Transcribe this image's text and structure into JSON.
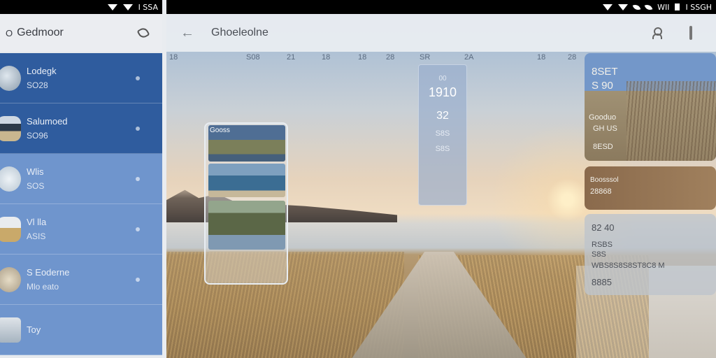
{
  "status_left": {
    "text": "I SSA"
  },
  "status_right": {
    "text1": "WII",
    "text2": "I SSGH"
  },
  "left": {
    "back_label": "O",
    "title": "Gedmoor",
    "items": [
      {
        "title": "Lodegk",
        "sub": "SO28"
      },
      {
        "title": "Salumoed",
        "sub": "SO96"
      },
      {
        "title": "Wlis",
        "sub": "SOS"
      },
      {
        "title": "Vl lla",
        "sub": "ASIS"
      },
      {
        "title": "S Eoderne",
        "sub": "Mlo eato"
      },
      {
        "title": "Toy",
        "sub": ""
      }
    ]
  },
  "right": {
    "title": "Ghoeleolne",
    "timeline": [
      "18",
      "S08",
      "21",
      "18",
      "18",
      "28",
      "SR",
      "2A",
      "18",
      "28"
    ],
    "gallery_title": "Gooss",
    "time_card": {
      "small": "00",
      "big": "1910",
      "med": "32",
      "tiny1": "S8S",
      "tiny2": "S8S"
    },
    "card1": {
      "line1": "8SET",
      "line2": "S 90",
      "line3": "Gooduo",
      "line4": "GH US",
      "line5": "8ESD"
    },
    "card2": {
      "line1": "Boosssol",
      "line2": "28868"
    },
    "card3": {
      "line1": "82 40",
      "line2": "RSBS",
      "line3": "S8S",
      "line4": "WBS8S8S8ST8C8 M",
      "line5": "8885"
    }
  },
  "colors": {
    "list_dark": "#2f5c9e",
    "list_light": "#6f95cd",
    "header": "#ebedf1"
  },
  "icons": [
    "wifi-icon",
    "leaf-icon",
    "battery-icon",
    "phone-icon",
    "back-arrow-icon",
    "person-icon",
    "mic-icon"
  ]
}
